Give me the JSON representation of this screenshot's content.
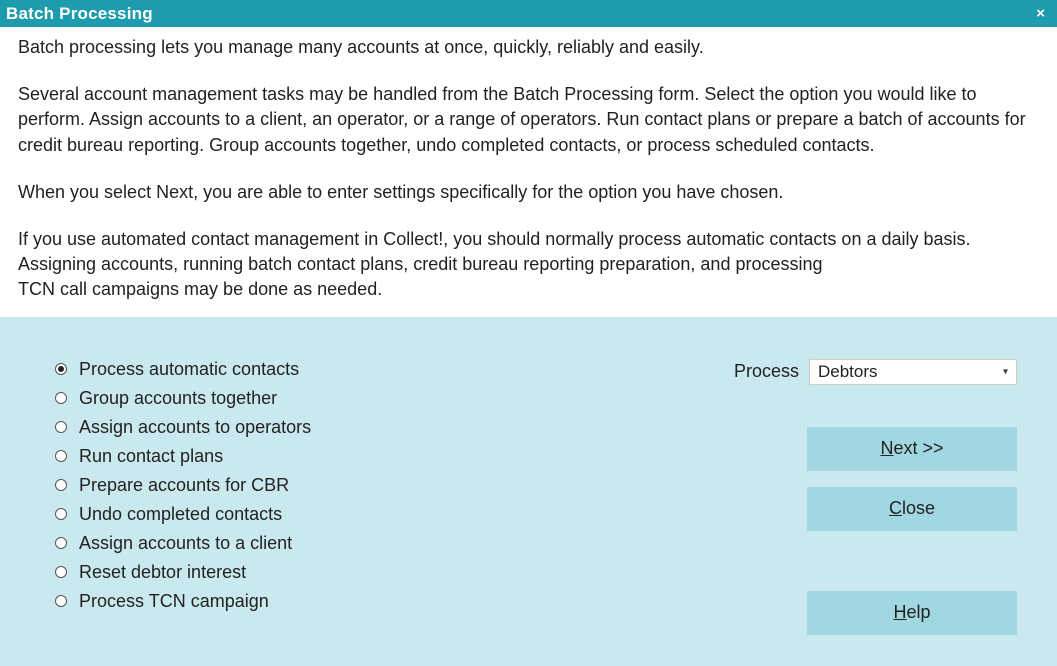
{
  "title": "Batch Processing",
  "close_glyph": "×",
  "description": {
    "p1": "Batch processing lets you manage many accounts at once, quickly, reliably and easily.",
    "p2": "Several account management tasks may be handled from the Batch Processing form. Select the option you would like to perform. Assign accounts to a client, an operator, or a range of operators. Run contact plans or prepare a batch of accounts for credit bureau reporting. Group accounts together, undo completed contacts, or process scheduled contacts.",
    "p3": "When you select Next, you are able to enter settings specifically for the option you have chosen.",
    "p4a": "If you use automated contact management in Collect!, you should normally process automatic contacts on a daily basis. Assigning accounts, running batch contact plans, credit bureau reporting preparation, and processing",
    "p4b": " TCN call campaigns may be done as needed."
  },
  "options": [
    {
      "label": "Process automatic contacts",
      "checked": true
    },
    {
      "label": "Group accounts together",
      "checked": false
    },
    {
      "label": "Assign accounts to operators",
      "checked": false
    },
    {
      "label": "Run contact plans",
      "checked": false
    },
    {
      "label": "Prepare accounts for CBR",
      "checked": false
    },
    {
      "label": "Undo completed contacts",
      "checked": false
    },
    {
      "label": "Assign accounts to a client",
      "checked": false
    },
    {
      "label": "Reset debtor interest",
      "checked": false
    },
    {
      "label": "Process TCN campaign",
      "checked": false
    }
  ],
  "process": {
    "label": "Process",
    "selected": "Debtors"
  },
  "buttons": {
    "next": {
      "prefix": "N",
      "rest": "ext >>"
    },
    "close": {
      "prefix": "C",
      "rest": "lose"
    },
    "help": {
      "prefix": "H",
      "rest": "elp"
    }
  }
}
